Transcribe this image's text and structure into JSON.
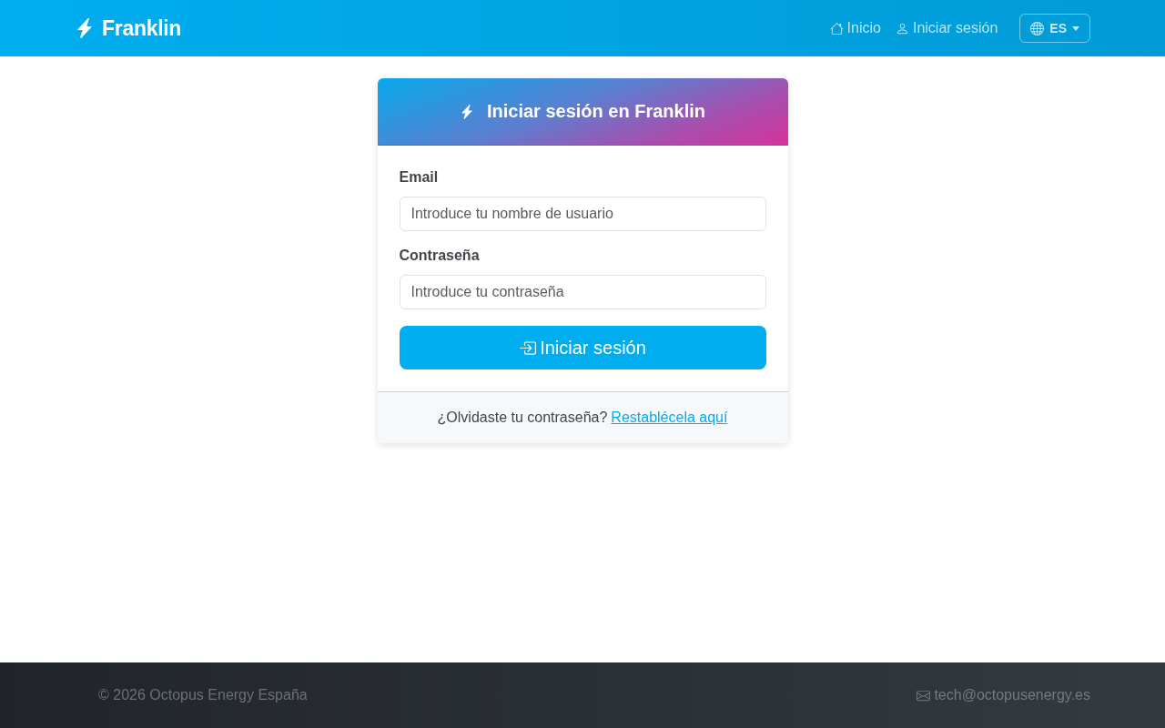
{
  "navbar": {
    "brand": "Franklin",
    "links": [
      {
        "label": "Inicio",
        "kind": "home"
      },
      {
        "label": "Iniciar sesión",
        "kind": "user"
      }
    ],
    "language": {
      "label": "ES"
    }
  },
  "login_card": {
    "title": "Iniciar sesión en Franklin",
    "fields": [
      {
        "label": "Email",
        "placeholder": "Introduce tu nombre de usuario"
      },
      {
        "label": "Contraseña",
        "placeholder": "Introduce tu contraseña"
      }
    ],
    "submit": "Iniciar sesión",
    "footer": {
      "text": "¿Olvidaste tu contraseña?",
      "link": "Restablécela aquí"
    }
  },
  "footer": {
    "copyright": "© 2026 Octopus Energy España",
    "email": "tech@octopusenergy.es"
  }
}
